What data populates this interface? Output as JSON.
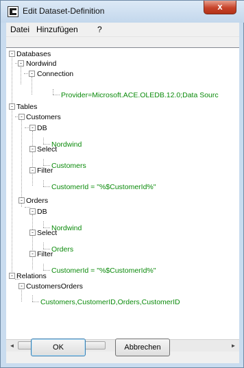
{
  "window": {
    "title": "Edit Dataset-Definition",
    "close_glyph": "x"
  },
  "menu": {
    "items": [
      "Datei",
      "Hinzufügen",
      "?"
    ]
  },
  "tree": {
    "databases": "Databases",
    "nordwind": "Nordwind",
    "connection": "Connection",
    "provider": "Provider=Microsoft.ACE.OLEDB.12.0;Data Sourc",
    "tables": "Tables",
    "customers": "Customers",
    "customers_db": "DB",
    "customers_db_value": "Nordwind",
    "customers_select": "Select",
    "customers_select_value": "Customers",
    "customers_filter": "Filter",
    "customers_filter_value": "CustomerId = \"%$CustomerId%\"",
    "orders": "Orders",
    "orders_db": "DB",
    "orders_db_value": "Nordwind",
    "orders_select": "Select",
    "orders_select_value": "Orders",
    "orders_filter": "Filter",
    "orders_filter_value": "CustomerId = \"%$CustomerId%\"",
    "relations": "Relations",
    "customers_orders": "CustomersOrders",
    "customers_orders_value": "Customers,CustomerID,Orders,CustomerID"
  },
  "scrollbar": {
    "left_arrow": "◄",
    "right_arrow": "►",
    "thumb_grip": "III"
  },
  "buttons": {
    "ok": "OK",
    "cancel": "Abbrechen"
  },
  "colors": {
    "leaf_text": "#0a8a0a",
    "close_button": "#c7432a"
  }
}
